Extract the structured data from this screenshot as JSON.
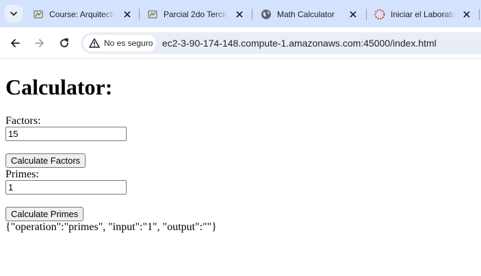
{
  "browser": {
    "tabs": [
      {
        "title": "Course: Arquitectura",
        "icon": "moodle-icon"
      },
      {
        "title": "Parcial 2do Tercio",
        "icon": "moodle-icon"
      },
      {
        "title": "Math Calculator",
        "icon": "globe-icon"
      },
      {
        "title": "Iniciar el Laboratorio",
        "icon": "loading-spinner-icon"
      }
    ],
    "security_label": "No es seguro",
    "url": "ec2-3-90-174-148.compute-1.amazonaws.com:45000/index.html"
  },
  "page": {
    "heading": "Calculator:",
    "factors": {
      "label": "Factors:",
      "value": "15",
      "button": "Calculate Factors"
    },
    "primes": {
      "label": "Primes:",
      "value": "1",
      "button": "Calculate Primes"
    },
    "result": "{\"operation\":\"primes\", \"input\":\"1\", \"output\":\"\"}"
  }
}
